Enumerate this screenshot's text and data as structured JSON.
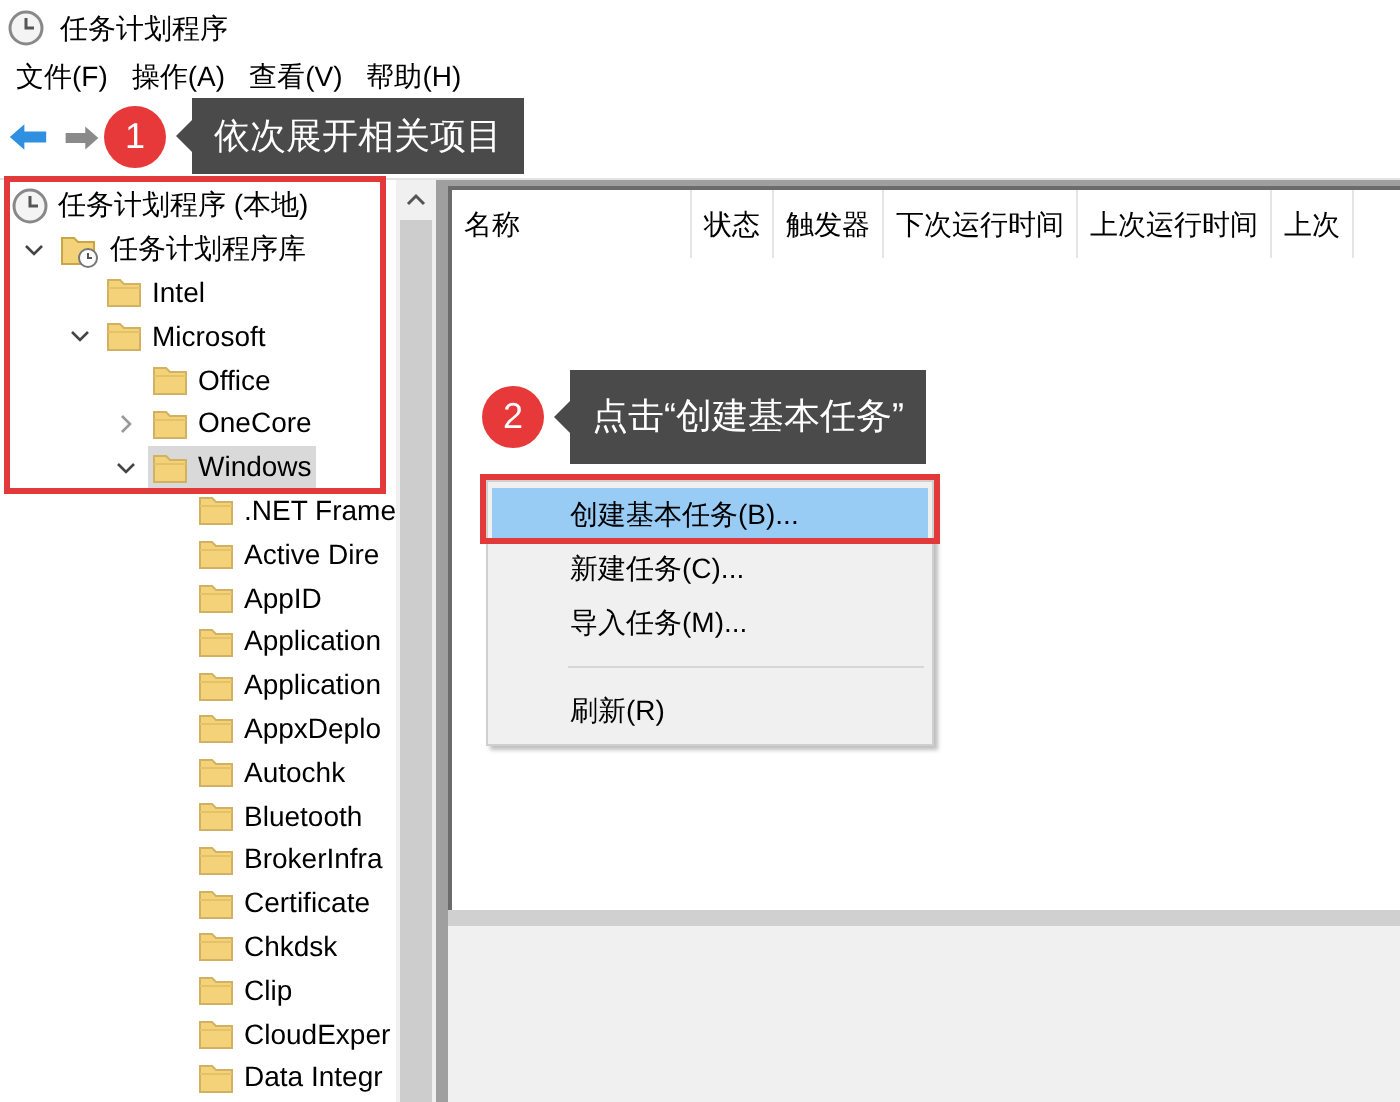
{
  "window": {
    "title": "任务计划程序"
  },
  "menu_bar": [
    {
      "label": "文件(F)"
    },
    {
      "label": "操作(A)"
    },
    {
      "label": "查看(V)"
    },
    {
      "label": "帮助(H)"
    }
  ],
  "tree": [
    {
      "label": "任务计划程序 (本地)",
      "kind": "root",
      "selected": false,
      "children": [
        {
          "label": "任务计划程序库",
          "kind": "library",
          "expanded": true,
          "selected": false,
          "children": [
            {
              "label": "Intel",
              "kind": "folder",
              "selected": false
            },
            {
              "label": "Microsoft",
              "kind": "folder",
              "expanded": true,
              "selected": false,
              "children": [
                {
                  "label": "Office",
                  "kind": "folder",
                  "selected": false
                },
                {
                  "label": "OneCore",
                  "kind": "folder",
                  "expanded": false,
                  "selected": false
                },
                {
                  "label": "Windows",
                  "kind": "folder",
                  "expanded": true,
                  "selected": true,
                  "children": [
                    {
                      "label": ".NET Frame",
                      "kind": "folder",
                      "selected": false
                    },
                    {
                      "label": "Active Dire",
                      "kind": "folder",
                      "selected": false
                    },
                    {
                      "label": "AppID",
                      "kind": "folder",
                      "selected": false
                    },
                    {
                      "label": "Application",
                      "kind": "folder",
                      "selected": false
                    },
                    {
                      "label": "Application",
                      "kind": "folder",
                      "selected": false
                    },
                    {
                      "label": "AppxDeplo",
                      "kind": "folder",
                      "selected": false
                    },
                    {
                      "label": "Autochk",
                      "kind": "folder",
                      "selected": false
                    },
                    {
                      "label": "Bluetooth",
                      "kind": "folder",
                      "selected": false
                    },
                    {
                      "label": "BrokerInfra",
                      "kind": "folder",
                      "selected": false
                    },
                    {
                      "label": "Certificate",
                      "kind": "folder",
                      "selected": false
                    },
                    {
                      "label": "Chkdsk",
                      "kind": "folder",
                      "selected": false
                    },
                    {
                      "label": "Clip",
                      "kind": "folder",
                      "selected": false
                    },
                    {
                      "label": "CloudExper",
                      "kind": "folder",
                      "selected": false
                    },
                    {
                      "label": "Data Integr",
                      "kind": "folder",
                      "selected": false
                    }
                  ]
                }
              ]
            }
          ]
        }
      ]
    }
  ],
  "table": {
    "columns": [
      "名称",
      "状态",
      "触发器",
      "下次运行时间",
      "上次运行时间",
      "上次"
    ]
  },
  "context_menu": [
    {
      "kind": "item",
      "label": "创建基本任务(B)...",
      "selected": true
    },
    {
      "kind": "item",
      "label": "新建任务(C)...",
      "selected": false
    },
    {
      "kind": "item",
      "label": "导入任务(M)...",
      "selected": false
    },
    {
      "kind": "separator"
    },
    {
      "kind": "item",
      "label": "刷新(R)",
      "selected": false
    }
  ],
  "callouts": [
    {
      "number": "1",
      "text": "依次展开相关项目"
    },
    {
      "number": "2",
      "text": "点击“创建基本任务”"
    }
  ]
}
